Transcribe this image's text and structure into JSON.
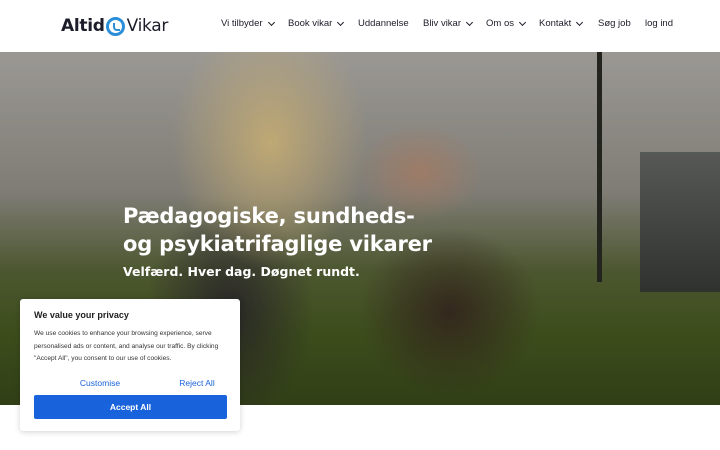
{
  "header": {
    "logo": {
      "left": "Altid",
      "right": "Vikar"
    },
    "nav": [
      {
        "label": "Vi tilbyder",
        "dropdown": true
      },
      {
        "label": "Book vikar",
        "dropdown": true
      },
      {
        "label": "Uddannelse",
        "dropdown": false
      },
      {
        "label": "Bliv vikar",
        "dropdown": true
      },
      {
        "label": "Om os",
        "dropdown": true
      },
      {
        "label": "Kontakt",
        "dropdown": true
      },
      {
        "label": "Søg job",
        "dropdown": false
      },
      {
        "label": "log ind",
        "dropdown": false
      }
    ]
  },
  "hero": {
    "title_line1": "Pædagogiske, sundheds-",
    "title_line2": "og psykiatrifaglige vikarer",
    "subtitle": "Velfærd. Hver dag. Døgnet rundt."
  },
  "cookie": {
    "title": "We value your privacy",
    "text": "We use cookies to enhance your browsing experience, serve personalised ads or content, and analyse our traffic. By clicking \"Accept All\", you consent to our use of cookies.",
    "customise_label": "Customise",
    "reject_label": "Reject All",
    "accept_label": "Accept All"
  },
  "colors": {
    "brand_blue": "#2a8fd8",
    "cookie_button": "#1863dc",
    "text_dark": "#1c1c2a"
  }
}
